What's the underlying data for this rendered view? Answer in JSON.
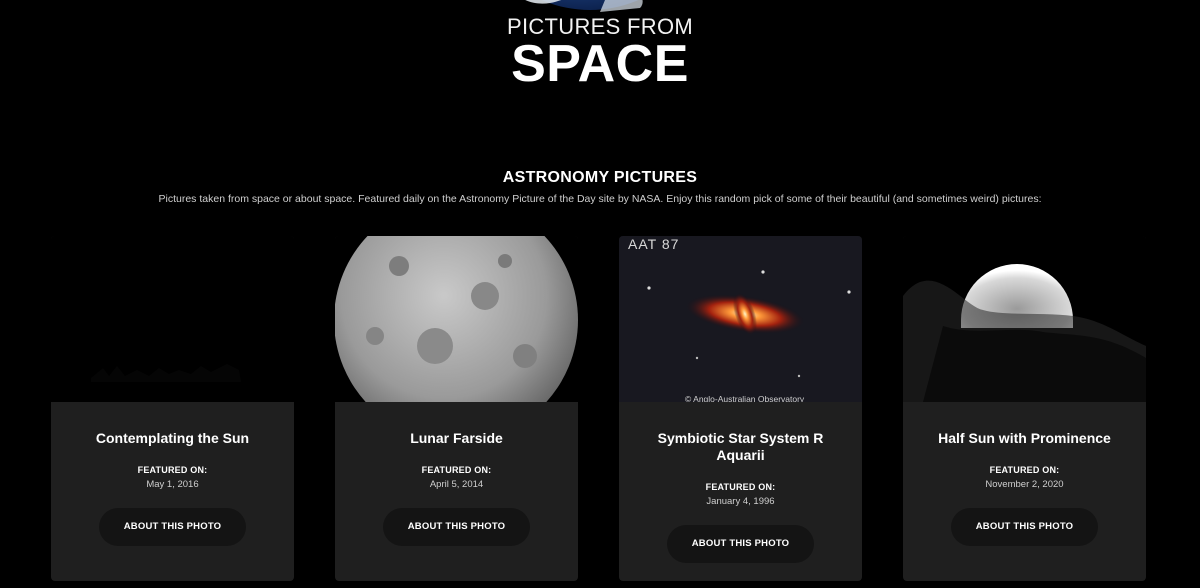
{
  "hero": {
    "subtitle": "PICTURES FROM",
    "title": "SPACE"
  },
  "section": {
    "title": "ASTRONOMY PICTURES",
    "description": "Pictures taken from space or about space. Featured daily on the Astronomy Picture of the Day site by NASA. Enjoy this random pick of some of their beautiful (and sometimes weird) pictures:"
  },
  "cards": [
    {
      "title": "Contemplating the Sun",
      "featured_label": "FEATURED ON:",
      "date": "May 1, 2016",
      "button": "ABOUT THIS PHOTO"
    },
    {
      "title": "Lunar Farside",
      "featured_label": "FEATURED ON:",
      "date": "April 5, 2014",
      "button": "ABOUT THIS PHOTO"
    },
    {
      "title": "Symbiotic Star System R Aquarii",
      "featured_label": "FEATURED ON:",
      "date": "January 4, 1996",
      "button": "ABOUT THIS PHOTO",
      "photo_label": "AAT 87",
      "photo_credit": "© Anglo-Australian Observatory"
    },
    {
      "title": "Half Sun with Prominence",
      "featured_label": "FEATURED ON:",
      "date": "November 2, 2020",
      "button": "ABOUT THIS PHOTO"
    }
  ],
  "colors": {
    "background": "#000000",
    "card": "#1f1f1f",
    "button": "#141414"
  }
}
